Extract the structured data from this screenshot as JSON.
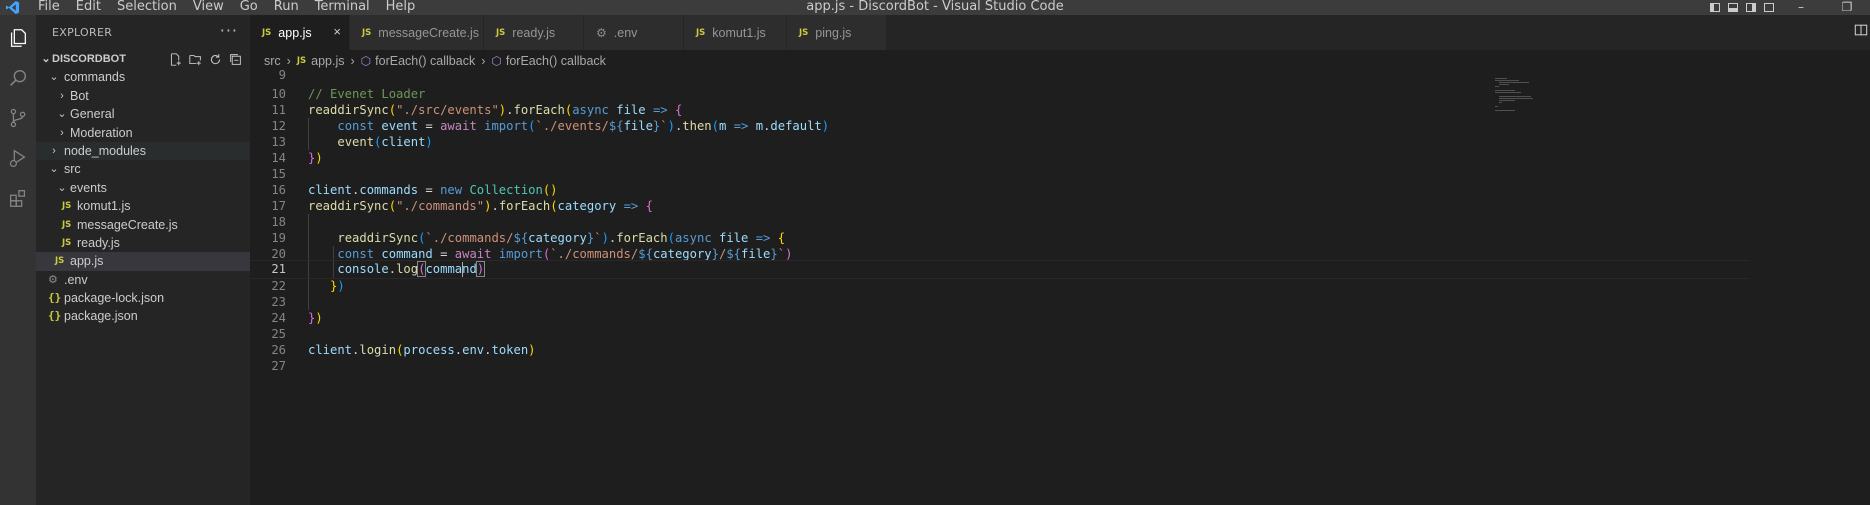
{
  "window": {
    "title": "app.js - DiscordBot - Visual Studio Code",
    "menu": [
      "File",
      "Edit",
      "Selection",
      "View",
      "Go",
      "Run",
      "Terminal",
      "Help"
    ]
  },
  "activity_bar": {
    "icons": [
      "explorer-icon",
      "search-icon",
      "source-control-icon",
      "run-debug-icon",
      "extensions-icon"
    ]
  },
  "sidebar": {
    "header": "EXPLORER",
    "more": "···",
    "project": "DISCORDBOT",
    "items": [
      {
        "label": "commands",
        "kind": "folder",
        "open": true
      },
      {
        "label": "Bot",
        "kind": "folder",
        "open": false
      },
      {
        "label": "General",
        "kind": "folder",
        "open": true
      },
      {
        "label": "Moderation",
        "kind": "folder",
        "open": false
      },
      {
        "label": "node_modules",
        "kind": "folder",
        "open": false
      },
      {
        "label": "src",
        "kind": "folder",
        "open": true
      },
      {
        "label": "events",
        "kind": "folder",
        "open": true
      },
      {
        "label": "komut1.js",
        "kind": "js"
      },
      {
        "label": "messageCreate.js",
        "kind": "js"
      },
      {
        "label": "ready.js",
        "kind": "js"
      },
      {
        "label": "app.js",
        "kind": "js",
        "selected": true
      },
      {
        "label": ".env",
        "kind": "env"
      },
      {
        "label": "package-lock.json",
        "kind": "json"
      },
      {
        "label": "package.json",
        "kind": "json"
      }
    ]
  },
  "tabs": [
    {
      "label": "app.js",
      "icon": "JS",
      "active": true,
      "close": "×"
    },
    {
      "label": "messageCreate.js",
      "icon": "JS"
    },
    {
      "label": "ready.js",
      "icon": "JS"
    },
    {
      "label": ".env",
      "icon": "gear"
    },
    {
      "label": "komut1.js",
      "icon": "JS"
    },
    {
      "label": "ping.js",
      "icon": "JS"
    }
  ],
  "breadcrumb": {
    "parts": [
      "src",
      "app.js",
      "forEach() callback",
      "forEach() callback"
    ],
    "js_icon": "JS"
  },
  "editor": {
    "line_numbers": [
      "9",
      "10",
      "11",
      "12",
      "13",
      "14",
      "15",
      "16",
      "17",
      "18",
      "19",
      "20",
      "21",
      "22",
      "23",
      "24",
      "25",
      "26",
      "27"
    ],
    "current_line": "21"
  },
  "colors": {
    "accent": "#007acc",
    "js_icon": "#cbcb41",
    "comment": "#6a9955",
    "string": "#ce9178",
    "keyword": "#569cd6",
    "control": "#c586c0",
    "function": "#dcdcaa",
    "variable": "#9cdcfe",
    "class": "#4ec9b0"
  }
}
